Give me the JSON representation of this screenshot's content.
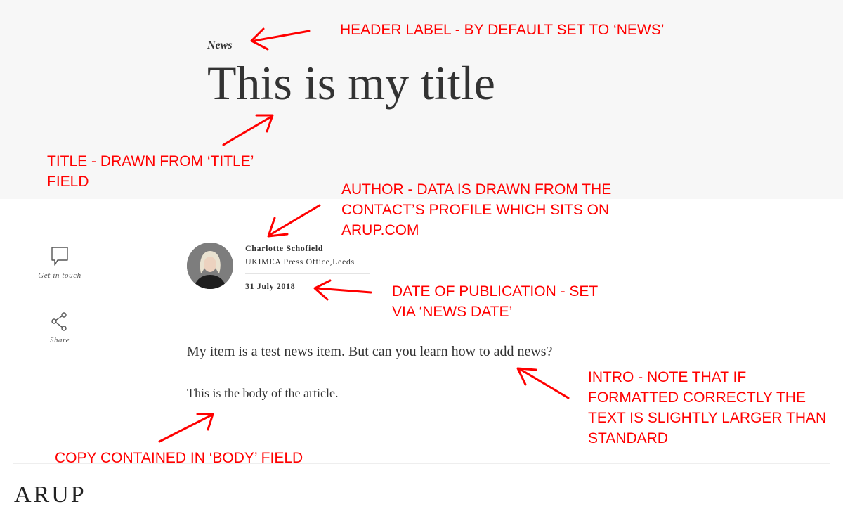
{
  "hero": {
    "label": "News",
    "title": "This is my title"
  },
  "side_rail": {
    "items": [
      {
        "label": "Get in touch",
        "icon": "speech-bubble-icon"
      },
      {
        "label": "Share",
        "icon": "share-icon"
      }
    ]
  },
  "author": {
    "name": "Charlotte Schofield",
    "role": "UKIMEA Press Office,Leeds",
    "date": "31 July 2018"
  },
  "article": {
    "intro": "My item is a test news item. But can you learn how to add news?",
    "body": "This is the body of the article."
  },
  "footer": {
    "logo": "ARUP"
  },
  "annotations": {
    "header_label": "HEADER LABEL - BY DEFAULT SET TO ‘NEWS’",
    "title": [
      "TITLE - DRAWN FROM ‘TITLE’",
      "FIELD"
    ],
    "author": [
      "AUTHOR - DATA IS DRAWN FROM THE",
      "CONTACT’S PROFILE WHICH SITS ON",
      "ARUP.COM"
    ],
    "date": [
      "DATE OF PUBLICATION - SET",
      "VIA ‘NEWS DATE’"
    ],
    "intro": [
      "INTRO - NOTE THAT IF",
      "FORMATTED CORRECTLY THE",
      "TEXT IS SLIGHTLY LARGER THAN",
      "STANDARD"
    ],
    "body": "COPY CONTAINED IN ‘BODY’ FIELD"
  },
  "colors": {
    "annotation": "#ff0000",
    "hero_background": "#f7f7f7",
    "text": "#333333"
  }
}
